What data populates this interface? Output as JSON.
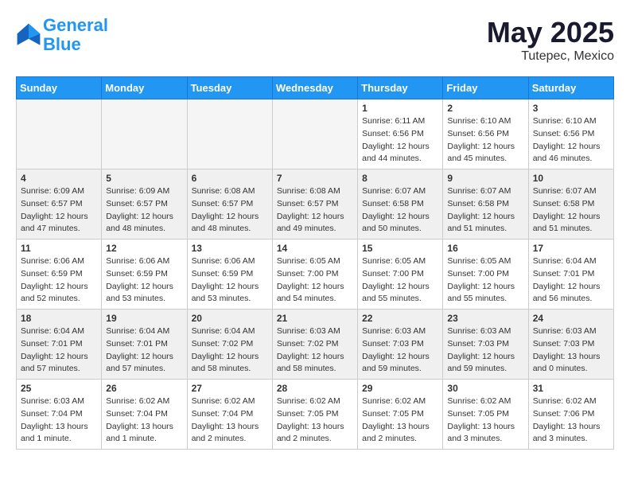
{
  "header": {
    "logo_line1": "General",
    "logo_line2": "Blue",
    "month": "May 2025",
    "location": "Tutepec, Mexico"
  },
  "weekdays": [
    "Sunday",
    "Monday",
    "Tuesday",
    "Wednesday",
    "Thursday",
    "Friday",
    "Saturday"
  ],
  "weeks": [
    [
      {
        "day": "",
        "info": ""
      },
      {
        "day": "",
        "info": ""
      },
      {
        "day": "",
        "info": ""
      },
      {
        "day": "",
        "info": ""
      },
      {
        "day": "1",
        "info": "Sunrise: 6:11 AM\nSunset: 6:56 PM\nDaylight: 12 hours\nand 44 minutes."
      },
      {
        "day": "2",
        "info": "Sunrise: 6:10 AM\nSunset: 6:56 PM\nDaylight: 12 hours\nand 45 minutes."
      },
      {
        "day": "3",
        "info": "Sunrise: 6:10 AM\nSunset: 6:56 PM\nDaylight: 12 hours\nand 46 minutes."
      }
    ],
    [
      {
        "day": "4",
        "info": "Sunrise: 6:09 AM\nSunset: 6:57 PM\nDaylight: 12 hours\nand 47 minutes."
      },
      {
        "day": "5",
        "info": "Sunrise: 6:09 AM\nSunset: 6:57 PM\nDaylight: 12 hours\nand 48 minutes."
      },
      {
        "day": "6",
        "info": "Sunrise: 6:08 AM\nSunset: 6:57 PM\nDaylight: 12 hours\nand 48 minutes."
      },
      {
        "day": "7",
        "info": "Sunrise: 6:08 AM\nSunset: 6:57 PM\nDaylight: 12 hours\nand 49 minutes."
      },
      {
        "day": "8",
        "info": "Sunrise: 6:07 AM\nSunset: 6:58 PM\nDaylight: 12 hours\nand 50 minutes."
      },
      {
        "day": "9",
        "info": "Sunrise: 6:07 AM\nSunset: 6:58 PM\nDaylight: 12 hours\nand 51 minutes."
      },
      {
        "day": "10",
        "info": "Sunrise: 6:07 AM\nSunset: 6:58 PM\nDaylight: 12 hours\nand 51 minutes."
      }
    ],
    [
      {
        "day": "11",
        "info": "Sunrise: 6:06 AM\nSunset: 6:59 PM\nDaylight: 12 hours\nand 52 minutes."
      },
      {
        "day": "12",
        "info": "Sunrise: 6:06 AM\nSunset: 6:59 PM\nDaylight: 12 hours\nand 53 minutes."
      },
      {
        "day": "13",
        "info": "Sunrise: 6:06 AM\nSunset: 6:59 PM\nDaylight: 12 hours\nand 53 minutes."
      },
      {
        "day": "14",
        "info": "Sunrise: 6:05 AM\nSunset: 7:00 PM\nDaylight: 12 hours\nand 54 minutes."
      },
      {
        "day": "15",
        "info": "Sunrise: 6:05 AM\nSunset: 7:00 PM\nDaylight: 12 hours\nand 55 minutes."
      },
      {
        "day": "16",
        "info": "Sunrise: 6:05 AM\nSunset: 7:00 PM\nDaylight: 12 hours\nand 55 minutes."
      },
      {
        "day": "17",
        "info": "Sunrise: 6:04 AM\nSunset: 7:01 PM\nDaylight: 12 hours\nand 56 minutes."
      }
    ],
    [
      {
        "day": "18",
        "info": "Sunrise: 6:04 AM\nSunset: 7:01 PM\nDaylight: 12 hours\nand 57 minutes."
      },
      {
        "day": "19",
        "info": "Sunrise: 6:04 AM\nSunset: 7:01 PM\nDaylight: 12 hours\nand 57 minutes."
      },
      {
        "day": "20",
        "info": "Sunrise: 6:04 AM\nSunset: 7:02 PM\nDaylight: 12 hours\nand 58 minutes."
      },
      {
        "day": "21",
        "info": "Sunrise: 6:03 AM\nSunset: 7:02 PM\nDaylight: 12 hours\nand 58 minutes."
      },
      {
        "day": "22",
        "info": "Sunrise: 6:03 AM\nSunset: 7:03 PM\nDaylight: 12 hours\nand 59 minutes."
      },
      {
        "day": "23",
        "info": "Sunrise: 6:03 AM\nSunset: 7:03 PM\nDaylight: 12 hours\nand 59 minutes."
      },
      {
        "day": "24",
        "info": "Sunrise: 6:03 AM\nSunset: 7:03 PM\nDaylight: 13 hours\nand 0 minutes."
      }
    ],
    [
      {
        "day": "25",
        "info": "Sunrise: 6:03 AM\nSunset: 7:04 PM\nDaylight: 13 hours\nand 1 minute."
      },
      {
        "day": "26",
        "info": "Sunrise: 6:02 AM\nSunset: 7:04 PM\nDaylight: 13 hours\nand 1 minute."
      },
      {
        "day": "27",
        "info": "Sunrise: 6:02 AM\nSunset: 7:04 PM\nDaylight: 13 hours\nand 2 minutes."
      },
      {
        "day": "28",
        "info": "Sunrise: 6:02 AM\nSunset: 7:05 PM\nDaylight: 13 hours\nand 2 minutes."
      },
      {
        "day": "29",
        "info": "Sunrise: 6:02 AM\nSunset: 7:05 PM\nDaylight: 13 hours\nand 2 minutes."
      },
      {
        "day": "30",
        "info": "Sunrise: 6:02 AM\nSunset: 7:05 PM\nDaylight: 13 hours\nand 3 minutes."
      },
      {
        "day": "31",
        "info": "Sunrise: 6:02 AM\nSunset: 7:06 PM\nDaylight: 13 hours\nand 3 minutes."
      }
    ]
  ]
}
